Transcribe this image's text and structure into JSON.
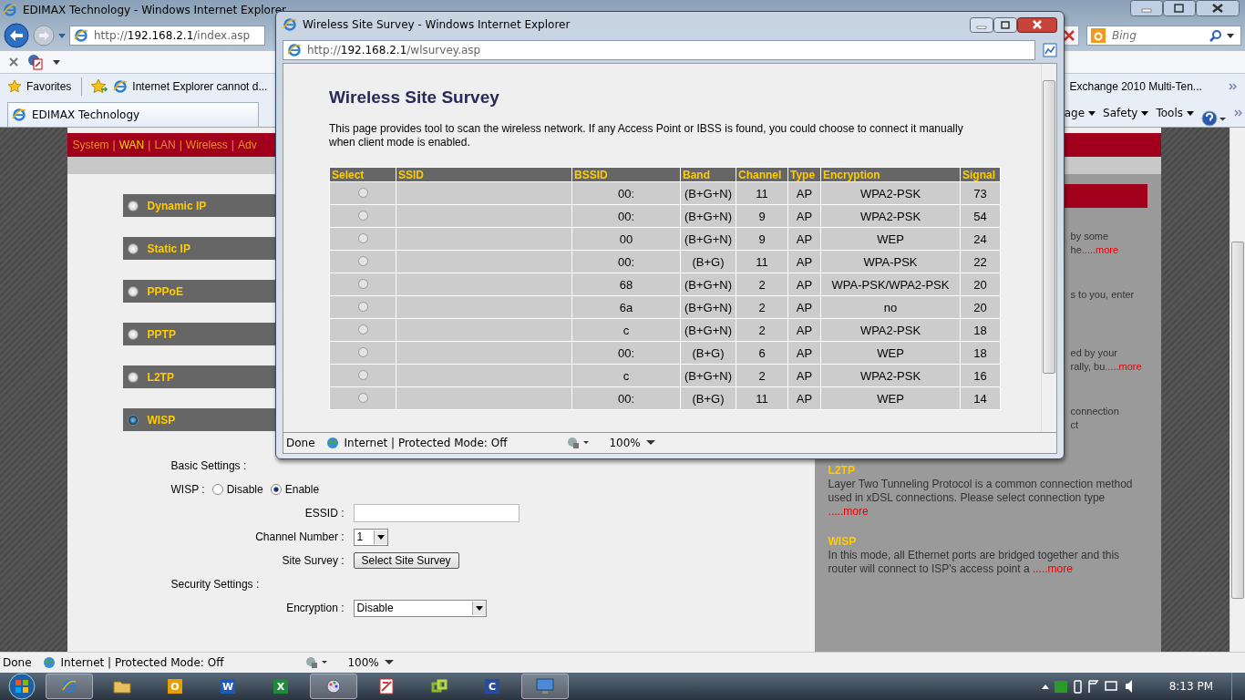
{
  "browser": {
    "title": "EDIMAX Technology - Windows Internet Explorer",
    "url": {
      "scheme": "http://",
      "host": "192.168.2.1",
      "path": "/index.asp"
    },
    "search": {
      "placeholder": "Bing"
    },
    "favorites": [
      {
        "label": "Favorites",
        "kind": "star"
      },
      {
        "label": "Internet Explorer cannot d...",
        "kind": "page"
      },
      {
        "label": "Exchange 2010 Multi-Ten...",
        "kind": "thumb"
      }
    ],
    "tab": {
      "label": "EDIMAX Technology"
    },
    "commands": [
      {
        "label": "age"
      },
      {
        "label": "Safety"
      },
      {
        "label": "Tools"
      }
    ],
    "status": {
      "text": "Done",
      "zone": "Internet | Protected Mode: Off",
      "zoom": "100%"
    }
  },
  "page": {
    "nav": [
      {
        "label": "System",
        "selected": false
      },
      {
        "label": "WAN",
        "selected": true
      },
      {
        "label": "LAN",
        "selected": false
      },
      {
        "label": "Wireless",
        "selected": false
      },
      {
        "label": "Adv",
        "selected": false
      }
    ],
    "nav_separator": "|",
    "modes": [
      {
        "label": "Dynamic IP",
        "selected": false
      },
      {
        "label": "Static IP",
        "selected": false
      },
      {
        "label": "PPPoE",
        "selected": false
      },
      {
        "label": "PPTP",
        "selected": false
      },
      {
        "label": "L2TP",
        "selected": false
      },
      {
        "label": "WISP",
        "selected": true
      }
    ],
    "form": [
      {
        "kind": "heading",
        "label": "Basic Settings :"
      },
      {
        "kind": "radios",
        "label": "WISP :",
        "options": [
          {
            "label": "Disable",
            "selected": false
          },
          {
            "label": "Enable",
            "selected": true
          }
        ]
      },
      {
        "kind": "input",
        "label": "ESSID :"
      },
      {
        "kind": "select",
        "label": "Channel Number :",
        "value": "1"
      },
      {
        "kind": "button",
        "label": "Site Survey :",
        "value": "Select Site Survey"
      },
      {
        "kind": "heading",
        "label": "Security Settings :"
      },
      {
        "kind": "select",
        "label": "Encryption :",
        "value": "Disable"
      }
    ],
    "help": [
      {
        "kind": "partial",
        "lines": [
          {
            "text": "by some"
          },
          {
            "text": "he",
            "more": ".....more"
          }
        ]
      },
      {
        "kind": "partial",
        "lines": [
          {
            "text": "s to you, enter"
          }
        ]
      },
      {
        "kind": "partial",
        "lines": [
          {
            "text": "ed by your"
          },
          {
            "text": "rally, bu",
            "more": ".....more"
          }
        ]
      },
      {
        "kind": "partial",
        "lines": [
          {
            "text": "connection"
          },
          {
            "text": "ct"
          }
        ]
      },
      {
        "kind": "entry",
        "title": "L2TP",
        "text": "Layer Two Tunneling Protocol is a common connection method used in xDSL connections. Please select connection type",
        "more": ".....more"
      },
      {
        "kind": "entry",
        "title": "WISP",
        "text": "In this mode, all Ethernet ports are bridged together and this router will connect to ISP's access point a",
        "more": ".....more"
      }
    ]
  },
  "popup": {
    "title": "Wireless Site Survey - Windows Internet Explorer",
    "url": {
      "scheme": "http://",
      "host": "192.168.2.1",
      "path": "/wlsurvey.asp"
    },
    "heading": "Wireless Site Survey",
    "description": "This page provides tool to scan the wireless network. If any Access Point or IBSS is found, you could choose to connect it manually when client mode is enabled.",
    "table": {
      "columns": [
        "Select",
        "SSID",
        "BSSID",
        "Band",
        "Channel",
        "Type",
        "Encryption",
        "Signal"
      ],
      "rows": [
        {
          "selected": false,
          "bssid": "00:",
          "band": "(B+G+N)",
          "channel": "11",
          "type": "AP",
          "encryption": "WPA2-PSK",
          "signal": "73"
        },
        {
          "selected": false,
          "bssid": "00:",
          "band": "(B+G+N)",
          "channel": "9",
          "type": "AP",
          "encryption": "WPA2-PSK",
          "signal": "54"
        },
        {
          "selected": false,
          "bssid": "00",
          "band": "(B+G+N)",
          "channel": "9",
          "type": "AP",
          "encryption": "WEP",
          "signal": "24"
        },
        {
          "selected": false,
          "bssid": "00:",
          "band": "(B+G)",
          "channel": "11",
          "type": "AP",
          "encryption": "WPA-PSK",
          "signal": "22"
        },
        {
          "selected": false,
          "bssid": "68",
          "band": "(B+G+N)",
          "channel": "2",
          "type": "AP",
          "encryption": "WPA-PSK/WPA2-PSK",
          "signal": "20"
        },
        {
          "selected": false,
          "bssid": "6a",
          "band": "(B+G+N)",
          "channel": "2",
          "type": "AP",
          "encryption": "no",
          "signal": "20"
        },
        {
          "selected": false,
          "bssid": "c",
          "band": "(B+G+N)",
          "channel": "2",
          "type": "AP",
          "encryption": "WPA2-PSK",
          "signal": "18"
        },
        {
          "selected": false,
          "bssid": "00:",
          "band": "(B+G)",
          "channel": "6",
          "type": "AP",
          "encryption": "WEP",
          "signal": "18"
        },
        {
          "selected": false,
          "bssid": "c",
          "band": "(B+G+N)",
          "channel": "2",
          "type": "AP",
          "encryption": "WPA2-PSK",
          "signal": "16"
        },
        {
          "selected": false,
          "bssid": "00:",
          "band": "(B+G)",
          "channel": "11",
          "type": "AP",
          "encryption": "WEP",
          "signal": "14"
        }
      ]
    },
    "status": {
      "text": "Done",
      "zone": "Internet | Protected Mode: Off",
      "zoom": "100%"
    }
  },
  "taskbar": {
    "apps": [
      {
        "kind": "ie",
        "selected": true
      },
      {
        "kind": "folder",
        "selected": false
      },
      {
        "kind": "letter",
        "label": "O",
        "color": "#e8a000",
        "selected": false
      },
      {
        "kind": "letter",
        "label": "W",
        "color": "#1e5bb8",
        "selected": false
      },
      {
        "kind": "letter",
        "label": "X",
        "color": "#1f8a3a",
        "selected": false
      },
      {
        "kind": "paint",
        "selected": true
      },
      {
        "kind": "pdf",
        "selected": false
      },
      {
        "kind": "link",
        "selected": false
      },
      {
        "kind": "letter",
        "label": "C",
        "color": "#2a4a9a",
        "selected": false
      },
      {
        "kind": "remote",
        "selected": true
      }
    ],
    "time": "8:13 PM"
  }
}
